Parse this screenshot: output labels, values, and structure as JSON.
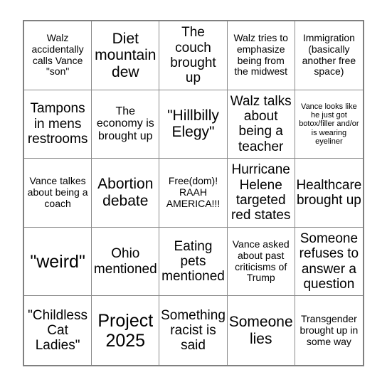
{
  "card": {
    "type": "bingo-card",
    "grid_size": 5,
    "background_color": "#ffffff",
    "border_color": "#808080",
    "text_color": "#000000",
    "rows": [
      [
        {
          "text": "Walz accidentally calls Vance \"son\"",
          "size": "sm"
        },
        {
          "text": "Diet mountain dew",
          "size": "xl"
        },
        {
          "text": "The couch brought up",
          "size": "lg"
        },
        {
          "text": "Walz tries to emphasize being from the midwest",
          "size": "sm"
        },
        {
          "text": "Immigration (basically another free space)",
          "size": "sm"
        }
      ],
      [
        {
          "text": "Tampons in mens restrooms",
          "size": "lg"
        },
        {
          "text": "The economy is brought up",
          "size": "md"
        },
        {
          "text": "\"Hillbilly Elegy\"",
          "size": "xl"
        },
        {
          "text": "Walz talks about being a teacher",
          "size": "lg"
        },
        {
          "text": "Vance looks like he just got botox/filler and/or is wearing eyeliner",
          "size": "xs"
        }
      ],
      [
        {
          "text": "Vance talkes about being a coach",
          "size": "sm"
        },
        {
          "text": "Abortion debate",
          "size": "xl"
        },
        {
          "text": "Free(dom)! RAAH AMERICA!!!",
          "size": "sm"
        },
        {
          "text": "Hurricane Helene targeted red states",
          "size": "lg"
        },
        {
          "text": "Healthcare brought up",
          "size": "lg"
        }
      ],
      [
        {
          "text": "\"weird\"",
          "size": "xxl"
        },
        {
          "text": "Ohio mentioned",
          "size": "lg"
        },
        {
          "text": "Eating pets mentioned",
          "size": "lg"
        },
        {
          "text": "Vance asked about past criticisms of Trump",
          "size": "sm"
        },
        {
          "text": "Someone refuses to answer a question",
          "size": "lg"
        }
      ],
      [
        {
          "text": "\"Childless Cat Ladies\"",
          "size": "lg"
        },
        {
          "text": "Project 2025",
          "size": "xxl"
        },
        {
          "text": "Something racist is said",
          "size": "lg"
        },
        {
          "text": "Someone lies",
          "size": "xl"
        },
        {
          "text": "Transgender brought up in some way",
          "size": "sm"
        }
      ]
    ]
  }
}
